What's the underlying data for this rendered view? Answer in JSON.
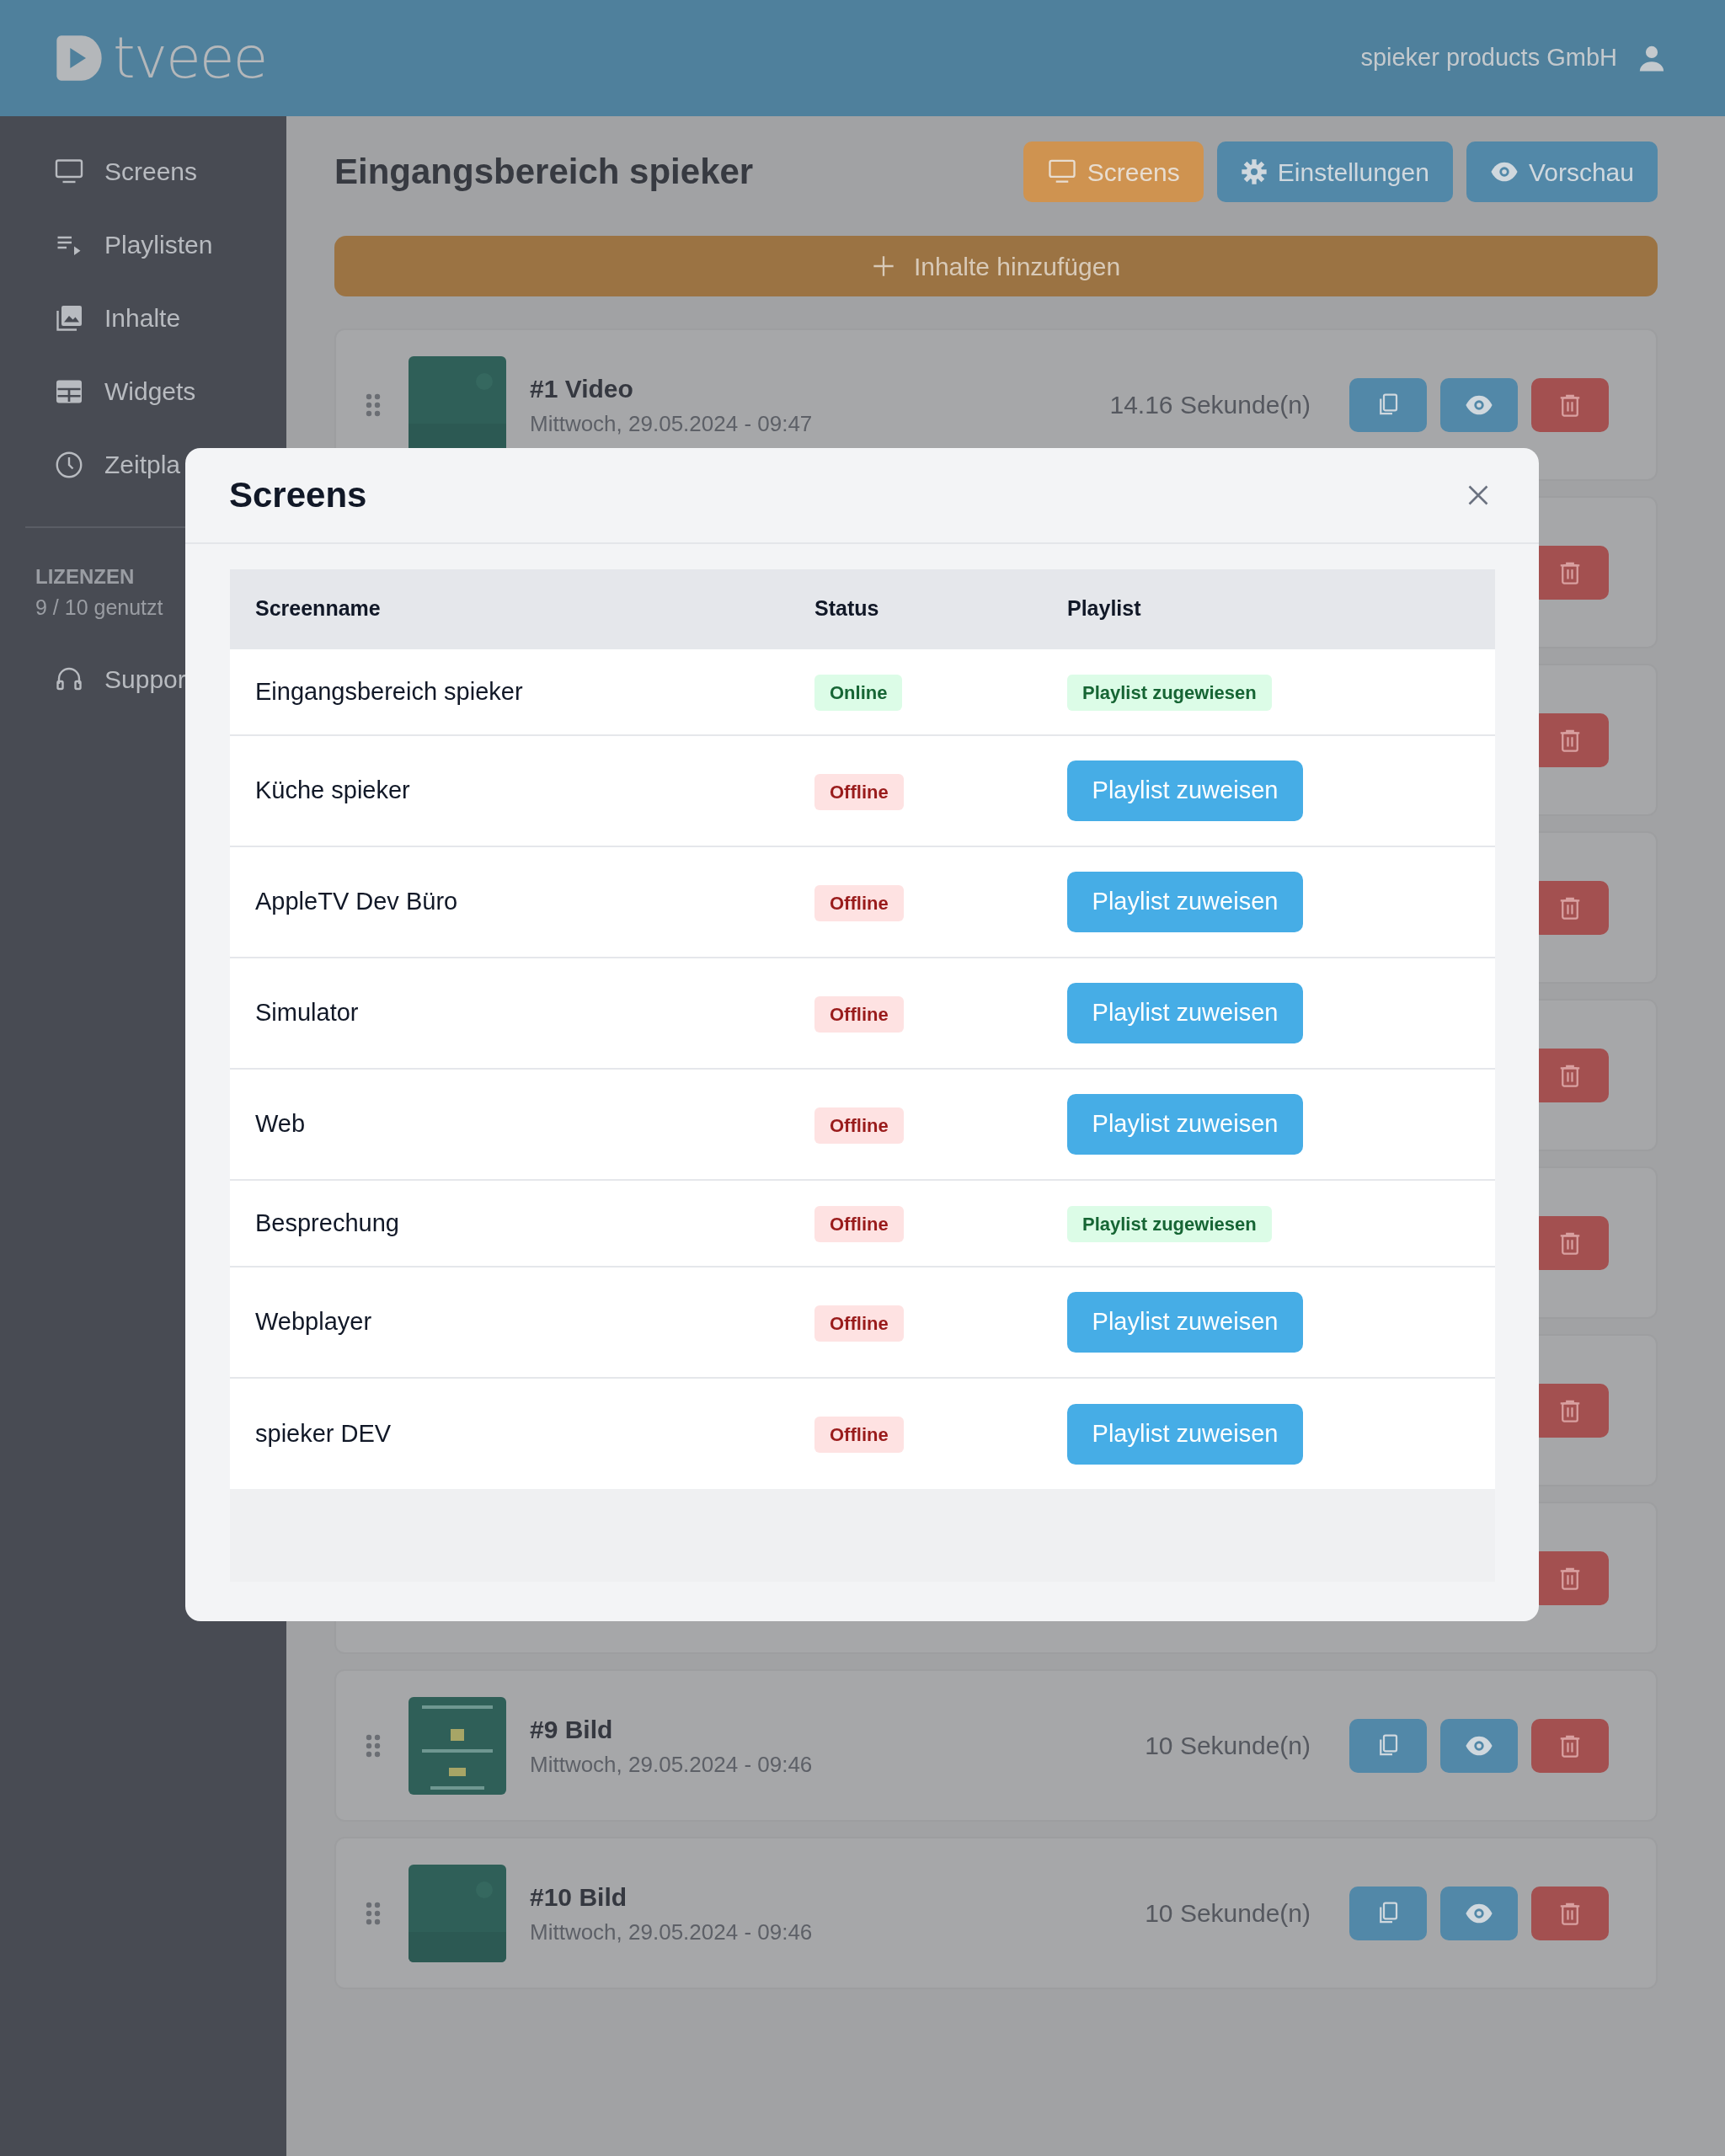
{
  "header": {
    "logo": "tveee",
    "account": "spieker products GmbH"
  },
  "sidebar": {
    "items": [
      {
        "label": "Screens"
      },
      {
        "label": "Playlisten"
      },
      {
        "label": "Inhalte"
      },
      {
        "label": "Widgets"
      },
      {
        "label": "Zeitpla"
      }
    ],
    "license_title": "LIZENZEN",
    "license_usage": "9 / 10 genutzt",
    "support": "Suppor"
  },
  "page": {
    "title": "Eingangsbereich spieker",
    "buttons": [
      {
        "label": "Screens",
        "kind": "warning"
      },
      {
        "label": "Einstellungen",
        "kind": "primary"
      },
      {
        "label": "Vorschau",
        "kind": "primary"
      }
    ],
    "add_button": "Inhalte hinzufügen",
    "items": [
      {
        "kind": "full",
        "title": "#1 Video",
        "date": "Mittwoch, 29.05.2024 - 09:47",
        "duration": "14.16 Sekunde(n)"
      },
      {
        "kind": "covered"
      },
      {
        "kind": "covered"
      },
      {
        "kind": "covered"
      },
      {
        "kind": "covered"
      },
      {
        "kind": "covered"
      },
      {
        "kind": "covered"
      },
      {
        "kind": "covered"
      },
      {
        "kind": "full",
        "title": "#9 Bild",
        "date": "Mittwoch, 29.05.2024 - 09:46",
        "duration": "10 Sekunde(n)"
      },
      {
        "kind": "full",
        "title": "#10 Bild",
        "date": "Mittwoch, 29.05.2024 - 09:46",
        "duration": "10 Sekunde(n)"
      }
    ]
  },
  "modal": {
    "title": "Screens",
    "columns": [
      "Screenname",
      "Status",
      "Playlist"
    ],
    "rows": [
      {
        "name": "Eingangsbereich spieker",
        "status": "Online",
        "online": true,
        "playlist": "Playlist zugewiesen",
        "assigned": true
      },
      {
        "name": "Küche spieker",
        "status": "Offline",
        "online": false,
        "playlist": "Playlist zuweisen",
        "assigned": false
      },
      {
        "name": "AppleTV Dev Büro",
        "status": "Offline",
        "online": false,
        "playlist": "Playlist zuweisen",
        "assigned": false
      },
      {
        "name": "Simulator",
        "status": "Offline",
        "online": false,
        "playlist": "Playlist zuweisen",
        "assigned": false
      },
      {
        "name": "Web",
        "status": "Offline",
        "online": false,
        "playlist": "Playlist zuweisen",
        "assigned": false
      },
      {
        "name": "Besprechung",
        "status": "Offline",
        "online": false,
        "playlist": "Playlist zugewiesen",
        "assigned": true
      },
      {
        "name": "Webplayer",
        "status": "Offline",
        "online": false,
        "playlist": "Playlist zuweisen",
        "assigned": false
      },
      {
        "name": "spieker DEV",
        "status": "Offline",
        "online": false,
        "playlist": "Playlist zuweisen",
        "assigned": false
      }
    ]
  }
}
